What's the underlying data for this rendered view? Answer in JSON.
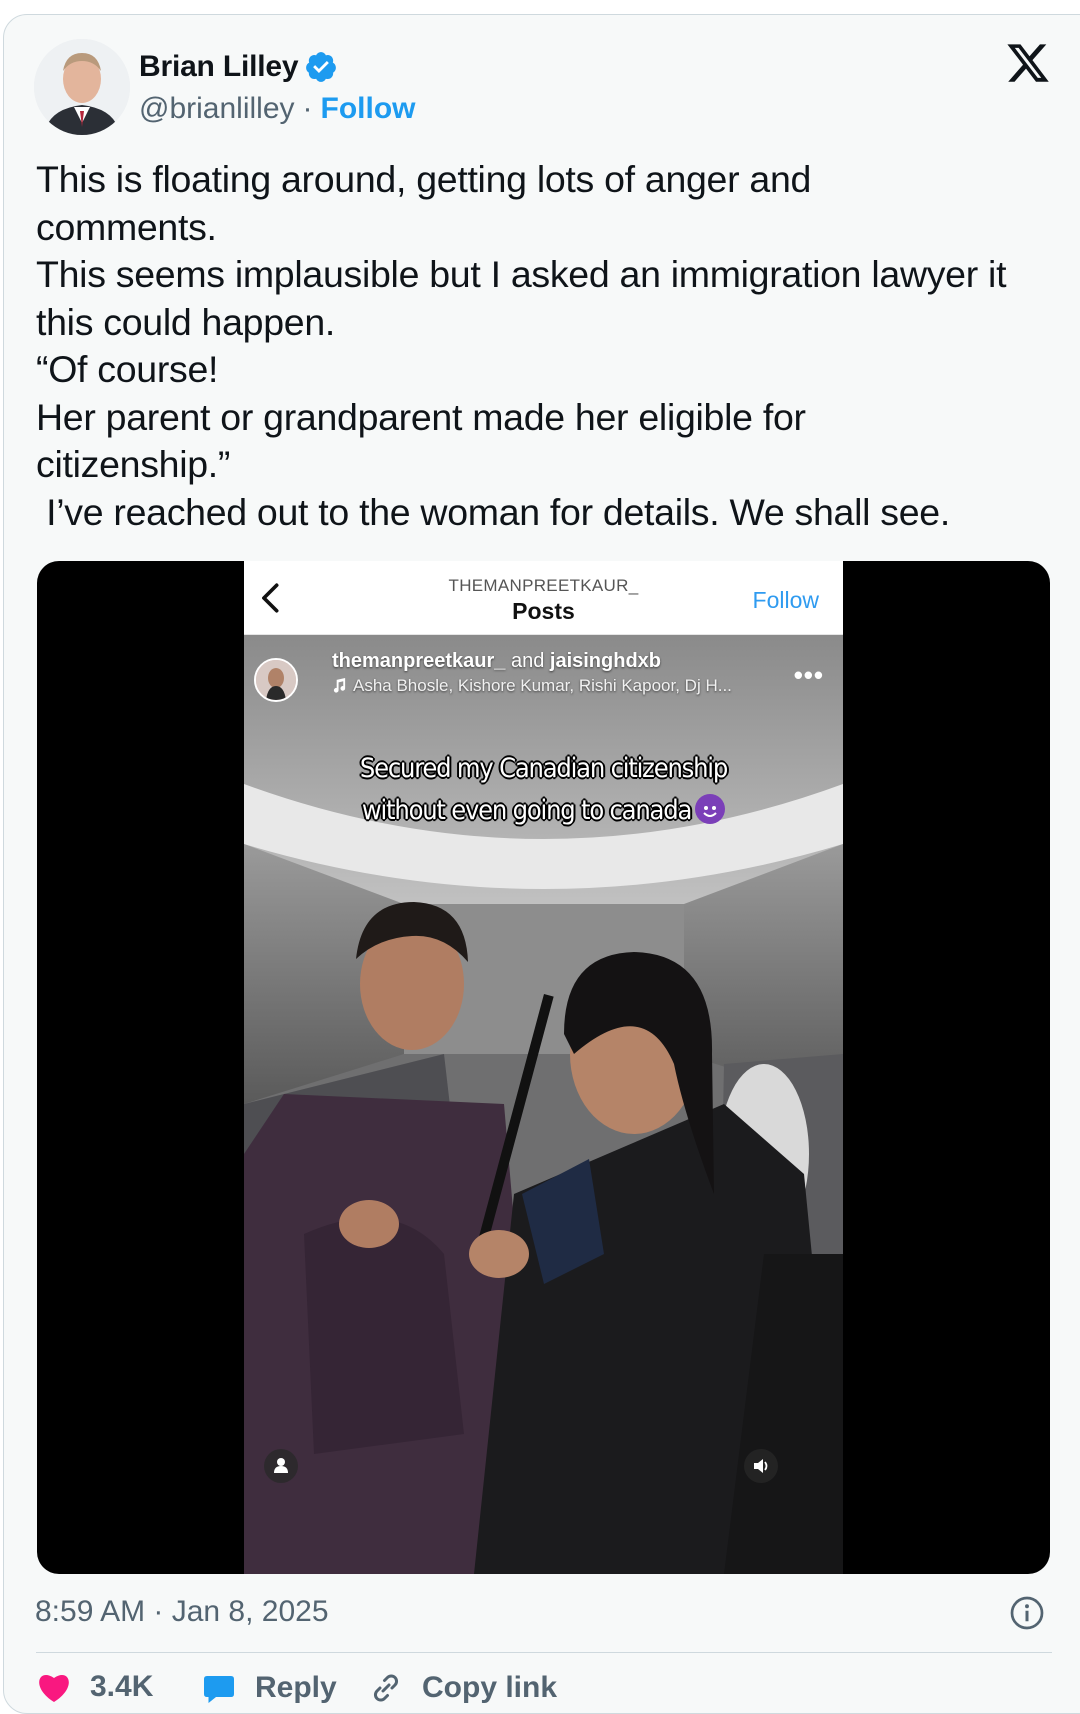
{
  "tweet": {
    "author_name": "Brian Lilley",
    "handle": "@brianlilley",
    "separator": "·",
    "follow_label": "Follow",
    "text": "This is floating around, getting lots of anger and\ncomments.\nThis seems implausible but I asked an immigration lawyer it\nthis could happen.\n“Of course!\nHer parent or grandparent made her eligible for\ncitizenship.”\n I’ve reached out to the woman for details. We shall see.",
    "timestamp": "8:59 AM · Jan 8, 2025"
  },
  "embed": {
    "account_header": "THEMANPREETKAUR_",
    "screen_title": "Posts",
    "follow_label": "Follow",
    "post_user_1": "themanpreetkaur_",
    "post_joiner": " and ",
    "post_user_2": "jaisinghdxb",
    "music": "Asha Bhosle,  Kishore Kumar,  Rishi Kapoor,  Dj H...",
    "more": "•••",
    "caption_line1": "Secured my Canadian citizenship",
    "caption_line2": "without even going to canada"
  },
  "actions": {
    "likes": "3.4K",
    "reply": "Reply",
    "copy_link": "Copy link"
  },
  "colors": {
    "brand_blue": "#1d9bf0",
    "like_red": "#f91880",
    "card_bg": "#f7f9f9"
  }
}
